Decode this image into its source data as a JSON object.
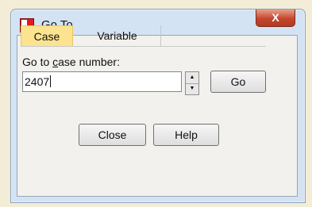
{
  "window": {
    "title": "Go To",
    "close_glyph": "X",
    "app_icon": "spss-data-editor-icon"
  },
  "tabs": [
    {
      "label": "Case",
      "selected": true
    },
    {
      "label": "Variable",
      "selected": false
    }
  ],
  "case_panel": {
    "label_prefix": "Go to ",
    "label_mnemonic": "c",
    "label_suffix": "ase number:",
    "input_value": "2407",
    "go_label": "Go"
  },
  "spinner": {
    "up": "▲",
    "down": "▼"
  },
  "footer": {
    "close_label": "Close",
    "help_label": "Help"
  },
  "colors": {
    "selected_tab": "#fbe38f",
    "title_close": "#c4462d",
    "frame": "#d4e3f3"
  }
}
